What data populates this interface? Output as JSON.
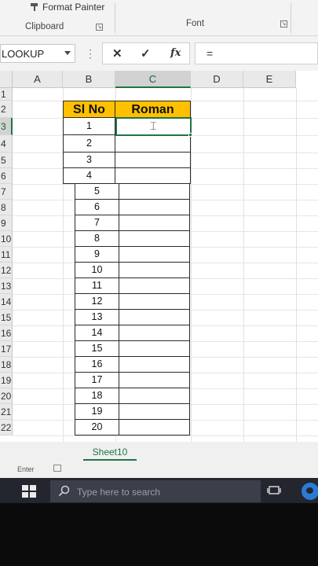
{
  "ribbon": {
    "format_painter_label": "Format Painter",
    "clipboard_group_label": "Clipboard",
    "font_group_label": "Font"
  },
  "formula_bar": {
    "name_box_value": "LOOKUP",
    "cancel_symbol": "✕",
    "enter_symbol": "✓",
    "function_symbol": "fx",
    "formula_value": "="
  },
  "columns": [
    "A",
    "B",
    "C",
    "D",
    "E"
  ],
  "selected_column": "C",
  "rows": [
    "1",
    "2",
    "3",
    "4",
    "5",
    "6",
    "7",
    "8",
    "9",
    "10",
    "11",
    "12",
    "13",
    "14",
    "15",
    "16",
    "17",
    "18",
    "19",
    "20",
    "21",
    "22"
  ],
  "selected_row": "3",
  "table": {
    "headers": [
      "Sl No",
      "Roman"
    ],
    "sl_no": [
      "1",
      "2",
      "3",
      "4",
      "5",
      "6",
      "7",
      "8",
      "9",
      "10",
      "11",
      "12",
      "13",
      "14",
      "15",
      "16",
      "17",
      "18",
      "19",
      "20"
    ]
  },
  "sheet_tab_label": "Sheet10",
  "status_mode": "Enter",
  "taskbar": {
    "search_placeholder": "Type here to search"
  },
  "colors": {
    "header_fill": "#ffc000",
    "excel_green": "#217346",
    "taskbar": "#23262f"
  }
}
